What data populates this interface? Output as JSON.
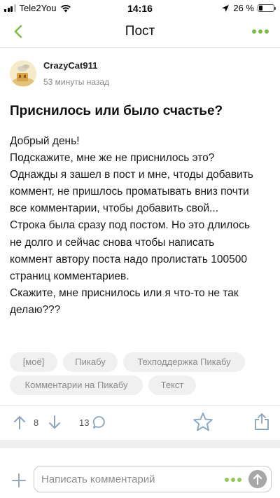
{
  "status_bar": {
    "carrier": "Tele2You",
    "time": "14:16",
    "battery": "26 %",
    "battery_level": 0.26
  },
  "header": {
    "title": "Пост"
  },
  "post": {
    "author": "CrazyCat911",
    "time": "53 минуты назад",
    "title": "Приснилось или было счастье?",
    "body": [
      "Добрый день!",
      "Подскажите, мне же не приснилось это?",
      "Однажды я зашел в пост и мне, чтоды добавить",
      "коммент, не пришлось проматывать вниз почти",
      "все комментарии, чтобы добавить свой...",
      "Строка была сразу под постом. Но это длилось",
      "не долго и сейчас снова чтобы написать",
      "коммент автору поста надо пролистать 100500",
      "страниц комментариев.",
      "Скажите, мне приснилось или я что-то не так",
      "делаю???"
    ],
    "tags": [
      "[моё]",
      "Пикабу",
      "Техподдержка Пикабу",
      "Комментарии на Пикабу",
      "Текст"
    ]
  },
  "actions": {
    "rating": "8",
    "comments_count": "13"
  },
  "comment_bar": {
    "placeholder": "Написать комментарий"
  },
  "colors": {
    "accent": "#7fbf3f",
    "tag_bg": "#f0f0f0",
    "muted": "#8b8b8b"
  }
}
